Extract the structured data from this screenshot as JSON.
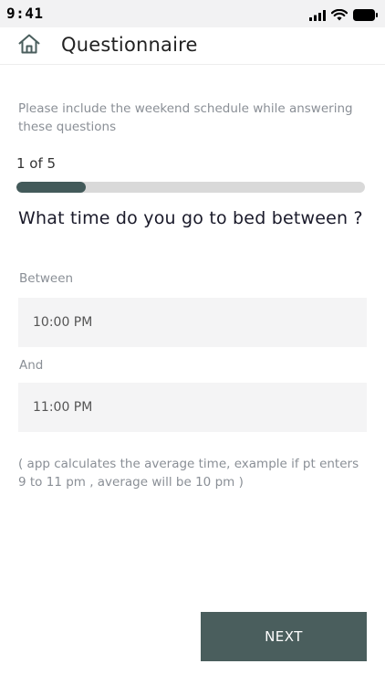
{
  "status_bar": {
    "time": "9:41",
    "icons": [
      "signal-icon",
      "wifi-icon",
      "battery-icon"
    ]
  },
  "header": {
    "home_icon": "home-icon",
    "title": "Questionnaire"
  },
  "instruction": "Please include the weekend schedule while answering these questions",
  "progress": {
    "text": "1 of 5",
    "current": 1,
    "total": 5,
    "fraction": 0.2
  },
  "question": "What time do you go to bed between ?",
  "fields": {
    "between_label": "Between",
    "between_value": "10:00 PM",
    "and_label": "And",
    "and_value": "11:00 PM"
  },
  "note": "( app calculates the  average time, example if pt enters 9 to 11 pm , average will be 10 pm )",
  "next_button": "NEXT",
  "colors": {
    "accent": "#4a5e5d",
    "progress_fill": "#435a5a",
    "progress_track": "#d9d9d9",
    "muted_text": "#8a8f96",
    "field_bg": "#f4f4f5"
  }
}
